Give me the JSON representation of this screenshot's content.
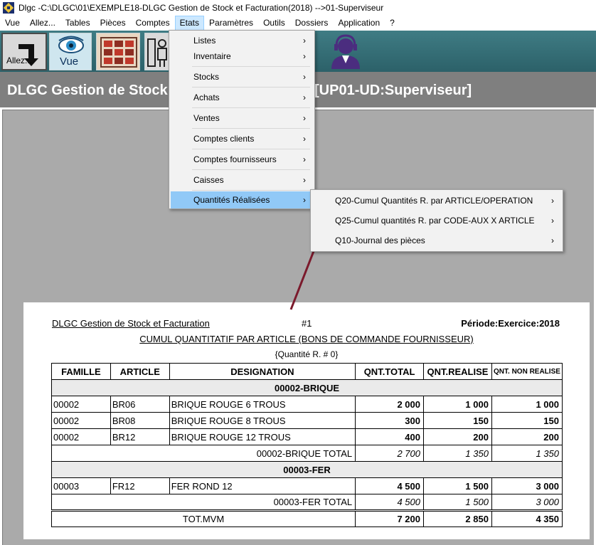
{
  "window": {
    "title": "Dlgc -C:\\DLGC\\01\\EXEMPLE18-DLGC Gestion de Stock et Facturation(2018) -->01-Superviseur"
  },
  "menubar": [
    "Vue",
    "Allez...",
    "Tables",
    "Pièces",
    "Comptes",
    "Etats",
    "Paramètres",
    "Outils",
    "Dossiers",
    "Application",
    "?"
  ],
  "toolbar": {
    "allez_label": "Allez...",
    "vue_label": "Vue"
  },
  "banner": {
    "left": "DLGC Gestion de Stock",
    "right": "[UP01-UD:Superviseur]"
  },
  "etats_menu": [
    "Listes",
    "Inventaire",
    "Stocks",
    "Achats",
    "Ventes",
    "Comptes clients",
    "Comptes fournisseurs",
    "Caisses",
    "Quantités Réalisées"
  ],
  "submenu": [
    "Q20-Cumul Quantités R. par ARTICLE/OPERATION",
    "Q25-Cumul quantités R. par CODE-AUX X ARTICLE",
    "Q10-Journal des pièces"
  ],
  "report": {
    "title": "DLGC Gestion de Stock et Facturation",
    "number": "#1",
    "period": "Période:Exercice:2018",
    "subtitle": "CUMUL QUANTITATIF PAR ARTICLE (BONS DE COMMANDE FOURNISSEUR)",
    "filter": "{Quantité R. # 0}",
    "headers": [
      "FAMILLE",
      "ARTICLE",
      "DESIGNATION",
      "QNT.TOTAL",
      "QNT.REALISE",
      "QNT. NON REALISE"
    ],
    "groups": [
      {
        "name": "00002-BRIQUE",
        "rows": [
          [
            "00002",
            "BR06",
            "BRIQUE ROUGE 6 TROUS",
            "2 000",
            "1 000",
            "1 000"
          ],
          [
            "00002",
            "BR08",
            "BRIQUE ROUGE 8 TROUS",
            "300",
            "150",
            "150"
          ],
          [
            "00002",
            "BR12",
            "BRIQUE ROUGE 12 TROUS",
            "400",
            "200",
            "200"
          ]
        ],
        "total_label": "00002-BRIQUE  TOTAL",
        "totals": [
          "2 700",
          "1 350",
          "1 350"
        ]
      },
      {
        "name": "00003-FER",
        "rows": [
          [
            "00003",
            "FR12",
            "FER ROND 12",
            "4 500",
            "1 500",
            "3 000"
          ]
        ],
        "total_label": "00003-FER  TOTAL",
        "totals": [
          "4 500",
          "1 500",
          "3 000"
        ]
      }
    ],
    "grand_total_label": "TOT.MVM",
    "grand_totals": [
      "7 200",
      "2 850",
      "4 350"
    ]
  }
}
